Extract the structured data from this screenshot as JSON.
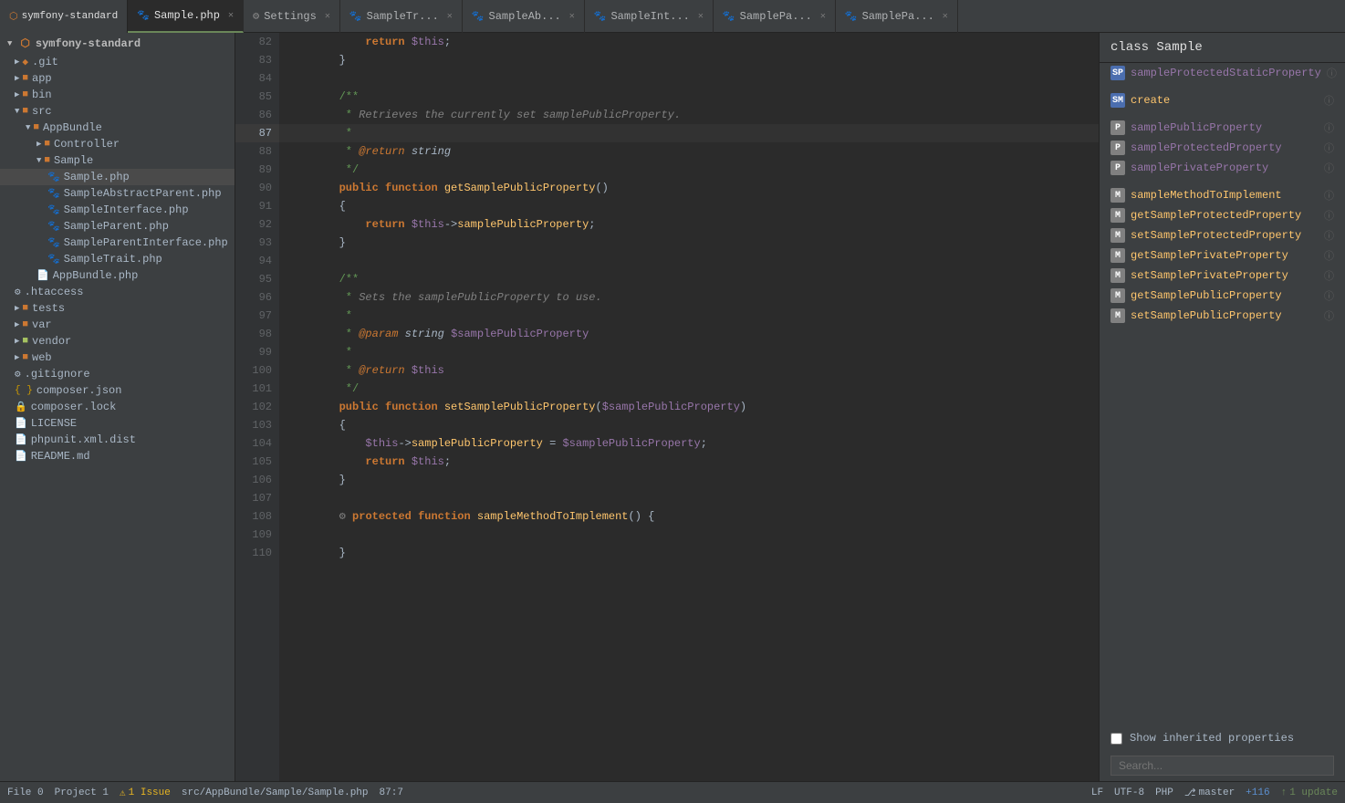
{
  "app": {
    "title": "symfony-standard"
  },
  "tabs": [
    {
      "id": "sample-php",
      "label": "Sample.php",
      "icon": "paw",
      "active": true,
      "closable": true
    },
    {
      "id": "settings",
      "label": "Settings",
      "icon": "gear",
      "active": false,
      "closable": true
    },
    {
      "id": "sample-trait",
      "label": "SampleTr...",
      "icon": "paw",
      "active": false,
      "closable": true
    },
    {
      "id": "sample-abstract",
      "label": "SampleAb...",
      "icon": "paw",
      "active": false,
      "closable": true
    },
    {
      "id": "sample-int",
      "label": "SampleInt...",
      "icon": "paw",
      "active": false,
      "closable": true
    },
    {
      "id": "sample-pa1",
      "label": "SamplePa...",
      "icon": "paw",
      "active": false,
      "closable": true
    },
    {
      "id": "sample-pa2",
      "label": "SamplePa...",
      "icon": "paw",
      "active": false,
      "closable": true
    }
  ],
  "sidebar": {
    "root_label": "symfony-standard",
    "items": [
      {
        "id": "git",
        "label": ".git",
        "type": "folder",
        "indent": 1,
        "arrow": "▶"
      },
      {
        "id": "app",
        "label": "app",
        "type": "folder",
        "indent": 1,
        "arrow": "▶"
      },
      {
        "id": "bin",
        "label": "bin",
        "type": "folder",
        "indent": 1,
        "arrow": "▶"
      },
      {
        "id": "src",
        "label": "src",
        "type": "folder",
        "indent": 1,
        "arrow": "▼",
        "open": true
      },
      {
        "id": "appbundle",
        "label": "AppBundle",
        "type": "folder",
        "indent": 2,
        "arrow": "▼",
        "open": true
      },
      {
        "id": "controller",
        "label": "Controller",
        "type": "folder",
        "indent": 3,
        "arrow": "▶"
      },
      {
        "id": "sample",
        "label": "Sample",
        "type": "folder",
        "indent": 3,
        "arrow": "▼",
        "open": true
      },
      {
        "id": "sample-php-file",
        "label": "Sample.php",
        "type": "file-paw",
        "indent": 4
      },
      {
        "id": "sampleabstractparent",
        "label": "SampleAbstractParent.php",
        "type": "file-paw",
        "indent": 4
      },
      {
        "id": "sampleinterface",
        "label": "SampleInterface.php",
        "type": "file-paw",
        "indent": 4
      },
      {
        "id": "sampleparent",
        "label": "SampleParent.php",
        "type": "file-paw",
        "indent": 4
      },
      {
        "id": "sampleparentinterface",
        "label": "SampleParentInterface.php",
        "type": "file-paw",
        "indent": 4
      },
      {
        "id": "sampletrait",
        "label": "SampleTrait.php",
        "type": "file-paw",
        "indent": 4
      },
      {
        "id": "appbundle-php",
        "label": "AppBundle.php",
        "type": "file",
        "indent": 3
      },
      {
        "id": "htaccess",
        "label": ".htaccess",
        "type": "file-gear",
        "indent": 1
      },
      {
        "id": "tests",
        "label": "tests",
        "type": "folder",
        "indent": 1,
        "arrow": "▶"
      },
      {
        "id": "var",
        "label": "var",
        "type": "folder",
        "indent": 1,
        "arrow": "▶"
      },
      {
        "id": "vendor",
        "label": "vendor",
        "type": "folder",
        "indent": 1,
        "arrow": "▶"
      },
      {
        "id": "web",
        "label": "web",
        "type": "folder",
        "indent": 1,
        "arrow": "▶"
      },
      {
        "id": "gitignore",
        "label": ".gitignore",
        "type": "file-gear",
        "indent": 1
      },
      {
        "id": "composer-json",
        "label": "composer.json",
        "type": "file-json",
        "indent": 1
      },
      {
        "id": "composer-lock",
        "label": "composer.lock",
        "type": "file",
        "indent": 1
      },
      {
        "id": "license",
        "label": "LICENSE",
        "type": "file",
        "indent": 1
      },
      {
        "id": "phpunit",
        "label": "phpunit.xml.dist",
        "type": "file",
        "indent": 1
      },
      {
        "id": "readme",
        "label": "README.md",
        "type": "file",
        "indent": 1
      }
    ]
  },
  "right_panel": {
    "title": "class Sample",
    "items": [
      {
        "type": "SP",
        "label": "sampleProtectedStaticProperty",
        "badge_class": "badge-sp",
        "has_info": true
      },
      {
        "type": "SM",
        "label": "create",
        "badge_class": "badge-sm",
        "has_info": true
      },
      {
        "type": "P",
        "label": "samplePublicProperty",
        "badge_class": "badge-p",
        "has_info": true
      },
      {
        "type": "P",
        "label": "sampleProtectedProperty",
        "badge_class": "badge-p",
        "has_info": true
      },
      {
        "type": "P",
        "label": "samplePrivateProperty",
        "badge_class": "badge-p",
        "has_info": true
      },
      {
        "type": "M",
        "label": "sampleMethodToImplement",
        "badge_class": "badge-m",
        "has_info": true
      },
      {
        "type": "M",
        "label": "getSampleProtectedProperty",
        "badge_class": "badge-m",
        "has_info": true
      },
      {
        "type": "M",
        "label": "setSampleProtectedProperty",
        "badge_class": "badge-m",
        "has_info": true
      },
      {
        "type": "M",
        "label": "getSamplePrivateProperty",
        "badge_class": "badge-m",
        "has_info": true
      },
      {
        "type": "M",
        "label": "setSamplePrivateProperty",
        "badge_class": "badge-m",
        "has_info": true
      },
      {
        "type": "M",
        "label": "getSamplePublicProperty",
        "badge_class": "badge-m",
        "has_info": true
      },
      {
        "type": "M",
        "label": "setSamplePublicProperty",
        "badge_class": "badge-m",
        "has_info": true
      }
    ],
    "checkbox_label": "Show inherited properties",
    "search_placeholder": "Search..."
  },
  "status_bar": {
    "file_count": "File 0",
    "project_count": "Project 1",
    "issue_count": "1 Issue",
    "file_path": "src/AppBundle/Sample/Sample.php",
    "position": "87:7",
    "line_ending": "LF",
    "encoding": "UTF-8",
    "file_type": "PHP",
    "vcs": "master",
    "changes": "+116",
    "update": "1 update"
  }
}
